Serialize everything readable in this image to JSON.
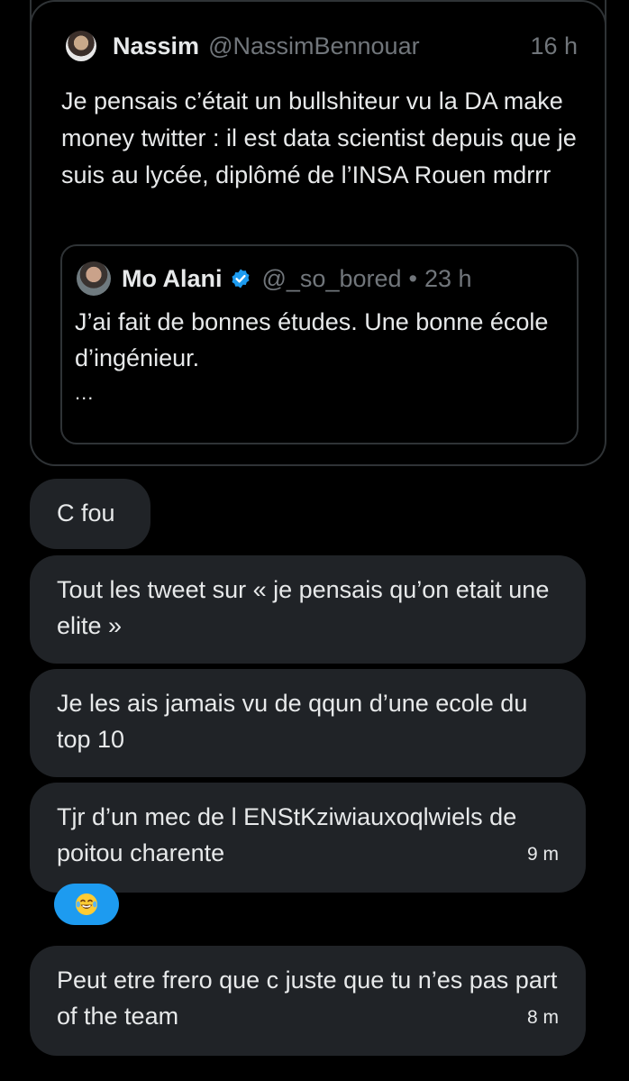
{
  "quoted_tweet": {
    "author_name": "Nassim",
    "author_handle": "@NassimBennouar",
    "time": "16 h",
    "text": "Je pensais c’était un bullshiteur vu la DA make money twitter : il est data scientist depuis que je suis au lycée, diplômé de l’INSA Rouen mdrrr",
    "inner_quote": {
      "author_name": "Mo Alani",
      "author_handle": "@_so_bored",
      "separator": "•",
      "time": "23 h",
      "text": "J’ai fait de bonnes études. Une bonne école d’ingénieur.",
      "more": "..."
    }
  },
  "messages": [
    {
      "text": "C fou",
      "time": ""
    },
    {
      "text": "Tout les tweet sur « je pensais qu’on etait une elite »",
      "time": ""
    },
    {
      "text": "Je les ais jamais vu de qqun d’une ecole du top 10",
      "time": ""
    },
    {
      "text": "Tjr d’un mec de l ENStKziwiauxoqlwiels de poitou charente",
      "time": "9 m"
    },
    {
      "text": "Peut etre frero que c juste que tu n’es pas part of the team",
      "time": "8 m"
    }
  ],
  "reaction": {
    "emoji": "face-with-tears-of-joy",
    "color": "#1d9bf0"
  },
  "colors": {
    "background": "#000000",
    "bubble": "#202327",
    "border": "#2f3336",
    "secondary_text": "#71767b",
    "verified": "#1d9bf0"
  }
}
